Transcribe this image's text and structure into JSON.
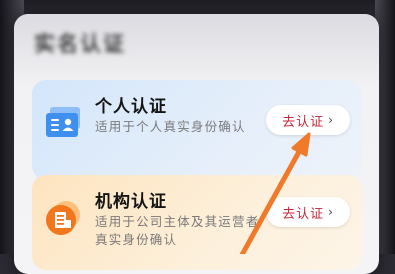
{
  "sheet": {
    "title": "实名认证"
  },
  "cards": [
    {
      "title": "个人认证",
      "description": "适用于个人真实身份确认",
      "button_label": "去认证",
      "button_chevron": "›",
      "icon": "id-card-icon"
    },
    {
      "title": "机构认证",
      "description": "适用于公司主体及其运营者真实身份确认",
      "button_label": "去认证",
      "button_chevron": "›",
      "icon": "building-icon"
    }
  ],
  "colors": {
    "accent": "#c4273a",
    "arrow": "#f07a2a",
    "personal_card": "#d9e8fb",
    "org_card": "#fde6c4"
  }
}
